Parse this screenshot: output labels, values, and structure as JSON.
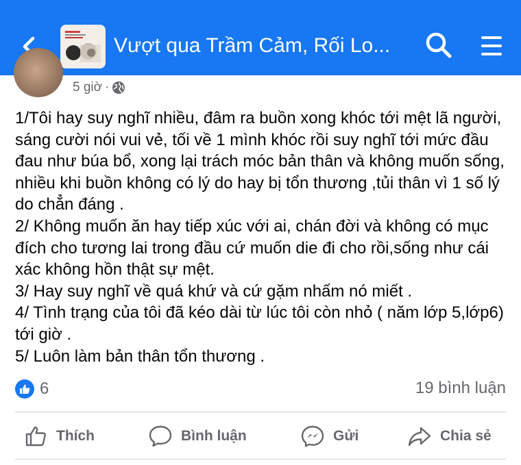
{
  "header": {
    "title": "Vượt qua Trầm Cảm, Rối Lo...",
    "icons": {
      "back": "chevron-left-icon",
      "search": "search-icon",
      "menu": "menu-icon"
    },
    "colors": {
      "bar": "#1877f2",
      "icon": "#ffffff"
    }
  },
  "post": {
    "time": "5 giờ",
    "separator": "·",
    "privacy_icon": "globe-icon",
    "lines": [
      "1/Tôi hay suy nghĩ nhiều, đâm ra buồn xong khóc tới mệt lã người, sáng cười nói vui vẻ, tối về 1 mình khóc rồi suy nghĩ tới mức đầu đau như búa bổ, xong lại trách móc bản thân và không muốn sống, nhiều khi buồn không có lý do hay bị tổn thương ,tủi thân vì 1 số lý do chẳn đáng .",
      "2/ Không muốn ăn hay tiếp xúc với ai, chán đời và không có mục đích cho tương lai trong đầu cứ muốn die đi cho rồi,sống như cái xác không hồn thật sự mệt.",
      "3/ Hay suy nghĩ về quá khứ và cứ gặm nhấm nó miết .",
      "4/ Tình trạng của tôi đã kéo dài từ lúc tôi còn nhỏ ( năm lớp 5,lớp6) tới giờ .",
      "5/ Luôn làm bản thân tổn thương ."
    ]
  },
  "stats": {
    "reaction_icon": "like-icon",
    "reaction_count": "6",
    "comments": "19 bình luận"
  },
  "actions": {
    "like": "Thích",
    "comment": "Bình luận",
    "send": "Gửi",
    "share": "Chia sẻ"
  }
}
